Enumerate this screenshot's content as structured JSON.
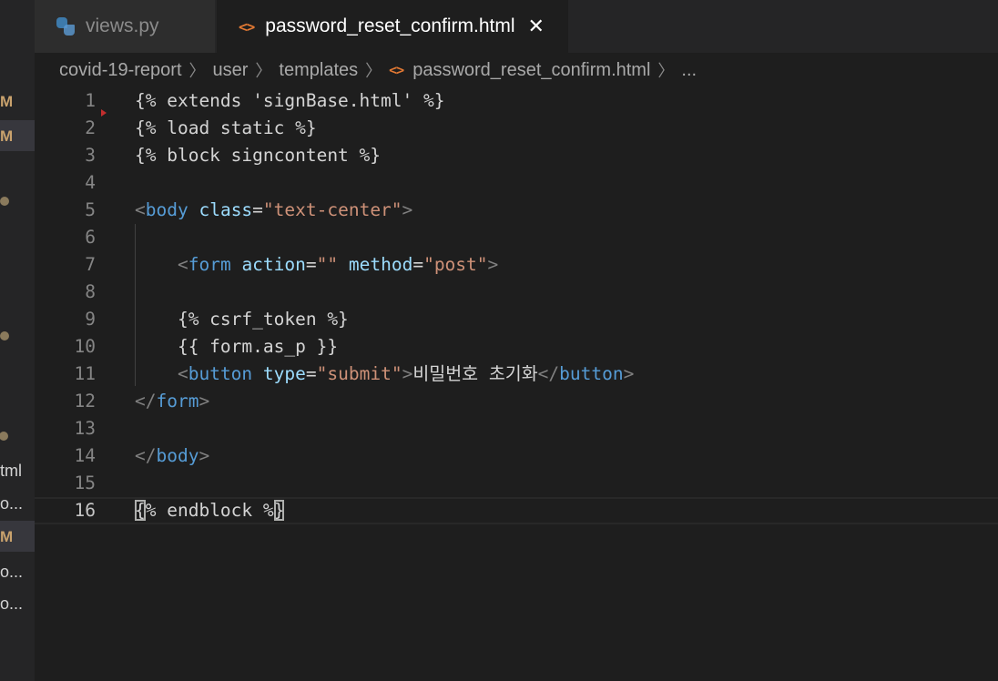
{
  "sidebar": {
    "items": [
      {
        "text": "M"
      },
      {
        "text": "M"
      },
      {
        "text": "tml"
      },
      {
        "text": "o..."
      },
      {
        "text": "M"
      },
      {
        "text": "o..."
      },
      {
        "text": "o..."
      }
    ]
  },
  "tabs": [
    {
      "label": "views.py",
      "icon": "python-file-icon",
      "active": false
    },
    {
      "label": "password_reset_confirm.html",
      "icon": "html-file-icon",
      "active": true
    }
  ],
  "breadcrumb": [
    "covid-19-report",
    "user",
    "templates",
    "password_reset_confirm.html",
    "..."
  ],
  "editor": {
    "current_line": 16,
    "lines": [
      {
        "n": "1",
        "text": "{% extends 'signBase.html' %}"
      },
      {
        "n": "2",
        "text": "{% load static %}"
      },
      {
        "n": "3",
        "text": "{% block signcontent %}"
      },
      {
        "n": "4",
        "text": ""
      },
      {
        "n": "5",
        "text": "<body class=\"text-center\">"
      },
      {
        "n": "6",
        "text": ""
      },
      {
        "n": "7",
        "text": "    <form action=\"\" method=\"post\">"
      },
      {
        "n": "8",
        "text": ""
      },
      {
        "n": "9",
        "text": "    {% csrf_token %}"
      },
      {
        "n": "10",
        "text": "    {{ form.as_p }}"
      },
      {
        "n": "11",
        "text": "    <button type=\"submit\">비밀번호 초기화</button>"
      },
      {
        "n": "12",
        "text": "</form>"
      },
      {
        "n": "13",
        "text": ""
      },
      {
        "n": "14",
        "text": "</body>"
      },
      {
        "n": "15",
        "text": ""
      },
      {
        "n": "16",
        "text": "{% endblock %}"
      }
    ]
  },
  "colors": {
    "background": "#1e1e1e",
    "tag": "#569cd6",
    "attribute": "#9cdcfe",
    "string": "#ce9178",
    "html_icon": "#e37933"
  }
}
